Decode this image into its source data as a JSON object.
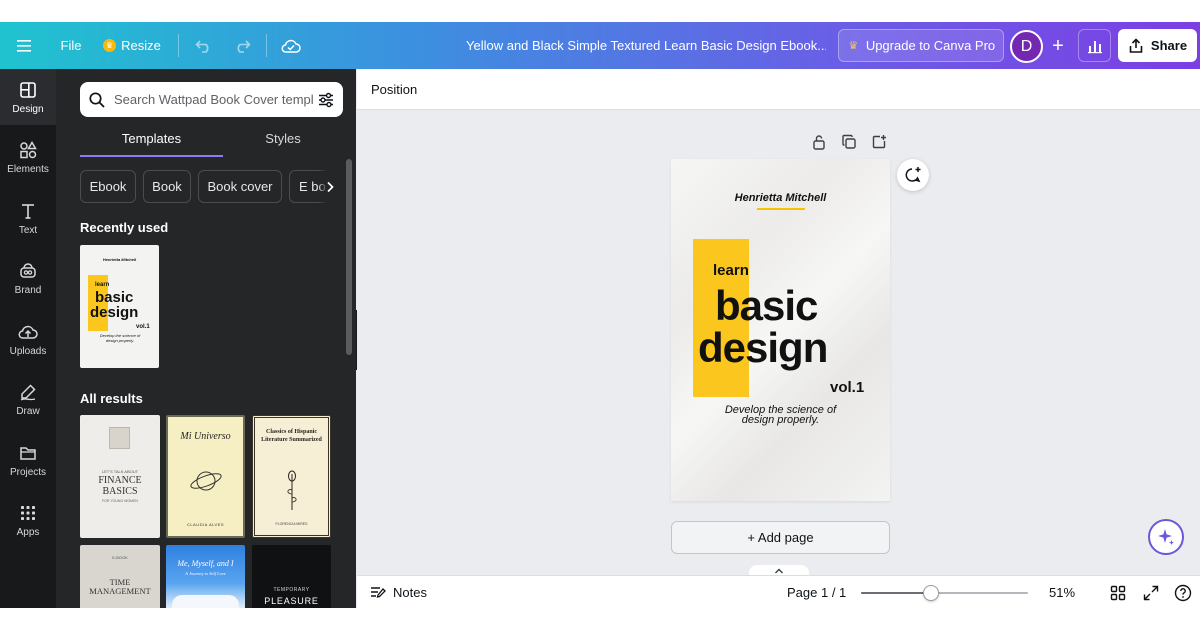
{
  "topbar": {
    "file_label": "File",
    "resize_label": "Resize",
    "document_title": "Yellow and Black Simple Textured Learn Basic Design Ebook...",
    "upgrade_label": "Upgrade to Canva Pro",
    "avatar_initial": "D",
    "share_label": "Share"
  },
  "rail": {
    "items": [
      {
        "label": "Design",
        "icon": "design-icon",
        "active": true
      },
      {
        "label": "Elements",
        "icon": "elements-icon"
      },
      {
        "label": "Text",
        "icon": "text-icon"
      },
      {
        "label": "Brand",
        "icon": "brand-icon"
      },
      {
        "label": "Uploads",
        "icon": "uploads-icon"
      },
      {
        "label": "Draw",
        "icon": "draw-icon"
      },
      {
        "label": "Projects",
        "icon": "projects-icon"
      },
      {
        "label": "Apps",
        "icon": "apps-icon"
      }
    ]
  },
  "panel": {
    "search_placeholder": "Search Wattpad Book Cover templ",
    "tabs": [
      "Templates",
      "Styles"
    ],
    "active_tab": "Templates",
    "chips": [
      "Ebook",
      "Book",
      "Book cover",
      "E bo"
    ],
    "recently_used_label": "Recently used",
    "all_results_label": "All results",
    "recent_thumb": {
      "author": "Henrietta Mitchell",
      "learn": "learn",
      "basic": "basic",
      "design": "design",
      "vol": "vol.1",
      "tagline": "Develop the science of design properly."
    },
    "results": [
      {
        "title_line1": "FINANCE",
        "title_line2": "BASICS",
        "kicker": "LET'S TALK ABOUT",
        "sub": "FOR YOUNG WOMEN"
      },
      {
        "title": "Mi Universo",
        "author": "CLAUDIA ALVES"
      },
      {
        "title": "Classics of Hispanic Literature Summarized",
        "author": "FLORENCIA MIRES"
      },
      {
        "title_line1": "TIME",
        "title_line2": "MANAGEMENT",
        "kicker": "E-BOOK"
      },
      {
        "title": "Me, Myself, and I",
        "sub": "A Journey to Self Love"
      },
      {
        "title_line1": "TEMPORARY",
        "title_line2": "PLEASURE"
      }
    ]
  },
  "editor": {
    "context_label": "Position",
    "cover": {
      "author": "Henrietta Mitchell",
      "learn": "learn",
      "basic": "basic",
      "design": "design",
      "vol": "vol.1",
      "tagline_line1": "Develop the science of",
      "tagline_line2": "design properly."
    },
    "add_page_label": "+ Add page",
    "notes_label": "Notes",
    "page_indicator": "Page 1 / 1",
    "zoom_percent": 51,
    "zoom_label": "51%",
    "zoom_slider_fraction": 0.42
  },
  "colors": {
    "accent": "#8b7df0",
    "cover_yellow": "#fbc61d",
    "avatar": "#7427b0",
    "panel_bg": "#252627",
    "rail_bg": "#18191b"
  }
}
